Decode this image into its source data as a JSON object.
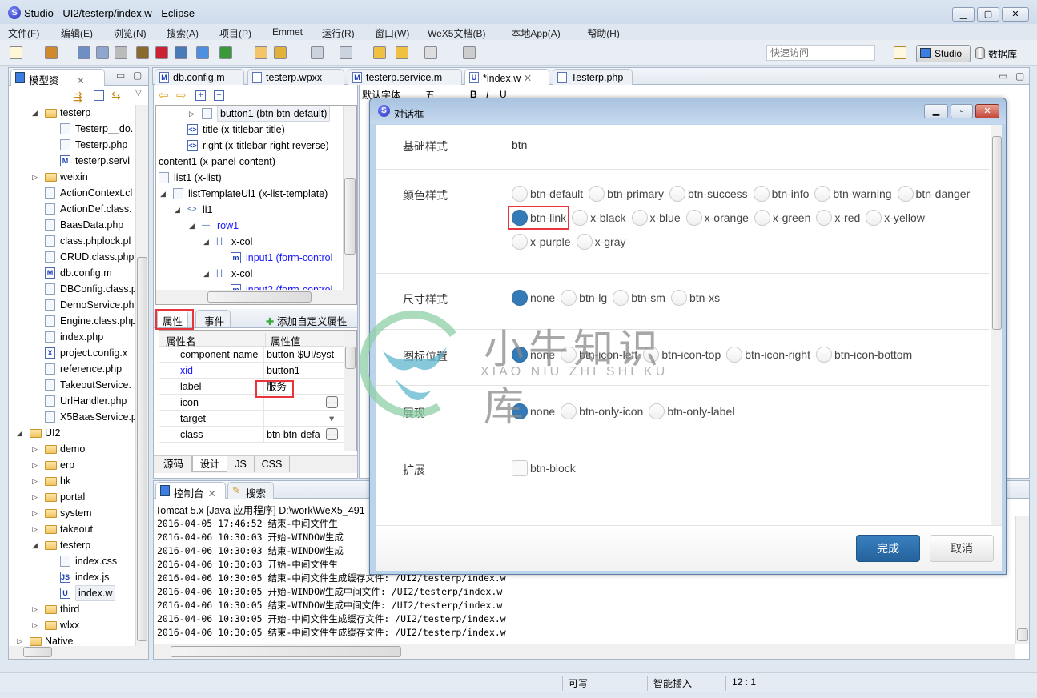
{
  "window": {
    "title": "Studio - UI2/testerp/index.w - Eclipse",
    "logo": "S"
  },
  "menu": [
    "文件(F)",
    "编辑(E)",
    "浏览(N)",
    "搜索(A)",
    "项目(P)",
    "Emmet",
    "运行(R)",
    "窗口(W)",
    "WeX5文档(B)",
    "本地App(A)",
    "帮助(H)"
  ],
  "toolbar": {
    "quick_access_placeholder": "快速访问",
    "studio_label": "Studio",
    "database_label": "数据库"
  },
  "left_panel": {
    "title": "模型资",
    "tree": [
      {
        "label": "testerp",
        "depth": 1,
        "expander": "expanded",
        "icon": "folder"
      },
      {
        "label": "Testerp__do.",
        "depth": 2,
        "expander": "none",
        "icon": "file"
      },
      {
        "label": "Testerp.php",
        "depth": 2,
        "expander": "none",
        "icon": "file"
      },
      {
        "label": "testerp.servi",
        "depth": 2,
        "expander": "none",
        "icon": "m-file"
      },
      {
        "label": "weixin",
        "depth": 1,
        "expander": "collapsed",
        "icon": "folder"
      },
      {
        "label": "ActionContext.cl",
        "depth": 1,
        "expander": "none",
        "icon": "file"
      },
      {
        "label": "ActionDef.class.",
        "depth": 1,
        "expander": "none",
        "icon": "file"
      },
      {
        "label": "BaasData.php",
        "depth": 1,
        "expander": "none",
        "icon": "file"
      },
      {
        "label": "class.phplock.pl",
        "depth": 1,
        "expander": "none",
        "icon": "file"
      },
      {
        "label": "CRUD.class.php",
        "depth": 1,
        "expander": "none",
        "icon": "file"
      },
      {
        "label": "db.config.m",
        "depth": 1,
        "expander": "none",
        "icon": "m-file"
      },
      {
        "label": "DBConfig.class.p",
        "depth": 1,
        "expander": "none",
        "icon": "file"
      },
      {
        "label": "DemoService.ph",
        "depth": 1,
        "expander": "none",
        "icon": "file"
      },
      {
        "label": "Engine.class.php",
        "depth": 1,
        "expander": "none",
        "icon": "file"
      },
      {
        "label": "index.php",
        "depth": 1,
        "expander": "none",
        "icon": "file"
      },
      {
        "label": "project.config.x",
        "depth": 1,
        "expander": "none",
        "icon": "x-file"
      },
      {
        "label": "reference.php",
        "depth": 1,
        "expander": "none",
        "icon": "file"
      },
      {
        "label": "TakeoutService.",
        "depth": 1,
        "expander": "none",
        "icon": "file"
      },
      {
        "label": "UrlHandler.php",
        "depth": 1,
        "expander": "none",
        "icon": "file"
      },
      {
        "label": "X5BaasService.p",
        "depth": 1,
        "expander": "none",
        "icon": "file"
      },
      {
        "label": "UI2",
        "depth": 0,
        "expander": "expanded",
        "icon": "project"
      },
      {
        "label": "demo",
        "depth": 1,
        "expander": "collapsed",
        "icon": "folder"
      },
      {
        "label": "erp",
        "depth": 1,
        "expander": "collapsed",
        "icon": "folder"
      },
      {
        "label": "hk",
        "depth": 1,
        "expander": "collapsed",
        "icon": "folder"
      },
      {
        "label": "portal",
        "depth": 1,
        "expander": "collapsed",
        "icon": "folder"
      },
      {
        "label": "system",
        "depth": 1,
        "expander": "collapsed",
        "icon": "folder"
      },
      {
        "label": "takeout",
        "depth": 1,
        "expander": "collapsed",
        "icon": "folder"
      },
      {
        "label": "testerp",
        "depth": 1,
        "expander": "expanded",
        "icon": "folder"
      },
      {
        "label": "index.css",
        "depth": 2,
        "expander": "none",
        "icon": "css-file"
      },
      {
        "label": "index.js",
        "depth": 2,
        "expander": "none",
        "icon": "js-file"
      },
      {
        "label": "index.w",
        "depth": 2,
        "expander": "none",
        "icon": "w-file",
        "selected": true
      },
      {
        "label": "third",
        "depth": 1,
        "expander": "collapsed",
        "icon": "folder"
      },
      {
        "label": "wlxx",
        "depth": 1,
        "expander": "collapsed",
        "icon": "folder"
      },
      {
        "label": "Native",
        "depth": 0,
        "expander": "collapsed",
        "icon": "project"
      }
    ]
  },
  "editor_tabs": [
    {
      "label": "db.config.m",
      "icon": "M"
    },
    {
      "label": "testerp.wpxx",
      "icon": "grid"
    },
    {
      "label": "testerp.service.m",
      "icon": "M"
    },
    {
      "label": "*index.w",
      "icon": "U",
      "active": true
    },
    {
      "label": "Testerp.php",
      "icon": "file"
    }
  ],
  "outline": {
    "tree": [
      {
        "label": "button1 (btn btn-default)",
        "depth": 3,
        "expander": "collapsed",
        "icon": "button",
        "selected": true
      },
      {
        "label": "title (x-titlebar-title)",
        "depth": 2,
        "expander": "none",
        "icon": "tag"
      },
      {
        "label": "right (x-titlebar-right reverse)",
        "depth": 2,
        "expander": "none",
        "icon": "tag"
      },
      {
        "label": "content1 (x-panel-content)",
        "depth": 0,
        "expander": "none",
        "icon": "none"
      },
      {
        "label": "list1 (x-list)",
        "depth": 0,
        "expander": "none",
        "icon": "list"
      },
      {
        "label": "listTemplateUl1 (x-list-template)",
        "depth": 1,
        "expander": "expanded",
        "icon": "list-template"
      },
      {
        "label": "li1",
        "depth": 2,
        "expander": "expanded",
        "icon": "angle"
      },
      {
        "label": "row1",
        "depth": 3,
        "expander": "expanded",
        "icon": "row",
        "blue": true
      },
      {
        "label": "x-col",
        "depth": 4,
        "expander": "expanded",
        "icon": "col"
      },
      {
        "label": "input1 (form-control",
        "depth": 5,
        "expander": "none",
        "icon": "input",
        "blue": true
      },
      {
        "label": "x-col",
        "depth": 4,
        "expander": "expanded",
        "icon": "col"
      },
      {
        "label": "input2 (form-control",
        "depth": 5,
        "expander": "none",
        "icon": "input",
        "blue": true
      }
    ]
  },
  "properties": {
    "tabs": [
      "属性",
      "事件"
    ],
    "add_custom": "添加自定义属性",
    "headers": [
      "属性名",
      "属性值"
    ],
    "rows": [
      {
        "name": "component-name",
        "value": "button-$UI/syst"
      },
      {
        "name": "xid",
        "value": "button1",
        "blue": true
      },
      {
        "name": "label",
        "value": "服务"
      },
      {
        "name": "icon",
        "value": "",
        "control": "ellipsis"
      },
      {
        "name": "target",
        "value": "",
        "control": "dropdown"
      },
      {
        "name": "class",
        "value": "btn btn-defa",
        "control": "ellipsis"
      }
    ],
    "bottom_tabs": [
      "源码",
      "设计",
      "JS",
      "CSS"
    ]
  },
  "editor_toolbar": {
    "font": "默认字体",
    "size": "五"
  },
  "console": {
    "tabs": [
      "控制台",
      "搜索"
    ],
    "header": "Tomcat 5.x [Java 应用程序] D:\\work\\WeX5_491",
    "lines": [
      "2016-04-05 17:46:52 结束-中间文件生",
      "2016-04-06 10:30:03 开始-WINDOW生成",
      "2016-04-06 10:30:03 结束-WINDOW生成",
      "2016-04-06 10:30:03 开始-中间文件生",
      "2016-04-06 10:30:05 结束-中间文件生成缓存文件: /UI2/testerp/index.w",
      "2016-04-06 10:30:05 开始-WINDOW生成中间文件: /UI2/testerp/index.w",
      "2016-04-06 10:30:05 结束-WINDOW生成中间文件: /UI2/testerp/index.w",
      "2016-04-06 10:30:05 开始-中间文件生成缓存文件: /UI2/testerp/index.w",
      "2016-04-06 10:30:05 结束-中间文件生成缓存文件: /UI2/testerp/index.w"
    ]
  },
  "dialog": {
    "title": "对话框",
    "sections": [
      {
        "label": "基础样式",
        "text": "btn"
      },
      {
        "label": "颜色样式",
        "type": "radio",
        "options": [
          "btn-default",
          "btn-primary",
          "btn-success",
          "btn-info",
          "btn-warning",
          "btn-danger",
          "btn-link",
          "x-black",
          "x-blue",
          "x-orange",
          "x-green",
          "x-red",
          "x-yellow",
          "x-purple",
          "x-gray"
        ],
        "selected": "btn-link",
        "highlighted": "btn-link"
      },
      {
        "label": "尺寸样式",
        "type": "radio",
        "options": [
          "none",
          "btn-lg",
          "btn-sm",
          "btn-xs"
        ],
        "selected": "none"
      },
      {
        "label": "图标位置",
        "type": "radio",
        "options": [
          "none",
          "btn-icon-left",
          "btn-icon-top",
          "btn-icon-right",
          "btn-icon-bottom"
        ],
        "selected": "none"
      },
      {
        "label": "展现",
        "type": "radio",
        "options": [
          "none",
          "btn-only-icon",
          "btn-only-label"
        ],
        "selected": "none"
      },
      {
        "label": "扩展",
        "type": "checkbox",
        "options": [
          "btn-block"
        ],
        "selected": ""
      }
    ],
    "ok": "完成",
    "cancel": "取消",
    "accent": "#337ab7"
  },
  "watermark": {
    "title": "小牛知识库",
    "subtitle": "XIAO NIU ZHI SHI KU"
  },
  "status": {
    "writable": "可写",
    "insert_mode": "智能插入",
    "position": "12 : 1"
  }
}
